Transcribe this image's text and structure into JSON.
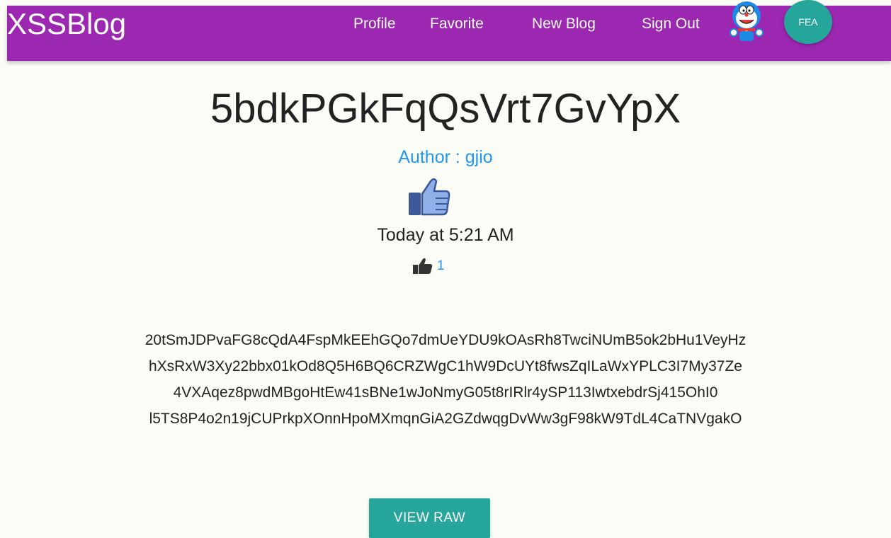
{
  "header": {
    "brand": "XSSBlog",
    "nav": {
      "profile": "Profile",
      "favorite": "Favorite",
      "new_blog": "New Blog",
      "sign_out": "Sign Out"
    },
    "avatar_initials": "FEA",
    "mascot_icon": "doraemon-mascot-icon",
    "bg_color": "#9c27b0"
  },
  "post": {
    "title": "5bdkPGkFqQsVrt7GvYpX",
    "author": "Author : gjio",
    "date": "Today at 5:21 AM",
    "like_count": "1",
    "content_lines": [
      "20tSmJDPvaFG8cQdA4FspMkEEhGQo7dmUeYDU9kOAsRh8TwciNUmB5ok2bHu1VeyHz",
      "hXsRxW3Xy22bbx01kOd8Q5H6BQ6CRZWgC1hW9DcUYt8fwsZqILaWxYPLC3I7My37Ze",
      "4VXAqez8pwdMBgoHtEw41sBNe1wJoNmyG05t8rIRlr4ySP113IwtxebdrSj415OhI0",
      "l5TS8P4o2n19jCUPrkpXOnnHpoMXmqnGiA2GZdwqgDvWw3gF98kW9TdL4CaTNVgakO"
    ],
    "view_raw_label": "VIEW RAW"
  },
  "colors": {
    "accent": "#2196f3",
    "teal": "#26a69a",
    "page_bg": "#fbfcf5"
  }
}
